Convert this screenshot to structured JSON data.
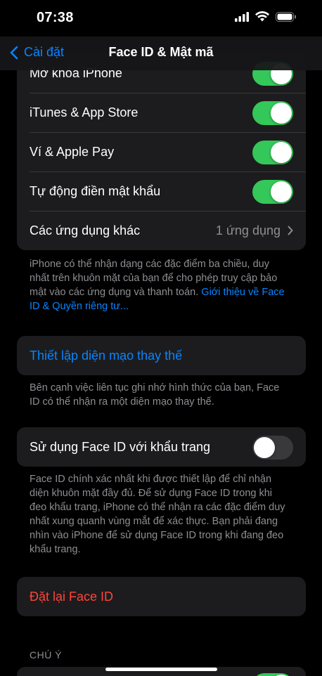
{
  "status": {
    "time": "07:38"
  },
  "nav": {
    "back_label": "Cài đặt",
    "title": "Face ID & Mật mã"
  },
  "use_for": {
    "rows": [
      {
        "label": "Mở khóa iPhone",
        "on": true
      },
      {
        "label": "iTunes & App Store",
        "on": true
      },
      {
        "label": "Ví & Apple Pay",
        "on": true
      },
      {
        "label": "Tự động điền mật khẩu",
        "on": true
      }
    ],
    "other_apps": {
      "label": "Các ứng dụng khác",
      "value": "1 ứng dụng"
    }
  },
  "footer1": {
    "text": "iPhone có thể nhận dạng các đặc điểm ba chiều, duy nhất trên khuôn mặt của bạn để cho phép truy cập bảo mật vào các ứng dụng và thanh toán. ",
    "link": "Giới thiệu về Face ID & Quyền riêng tư..."
  },
  "alt_appearance": {
    "label": "Thiết lập diện mạo thay thế",
    "footer": "Bên cạnh việc liên tục ghi nhớ hình thức của bạn, Face ID có thể nhận ra một diện mạo thay thế."
  },
  "mask": {
    "label": "Sử dụng Face ID với khẩu trang",
    "on": false,
    "footer": "Face ID chính xác nhất khi được thiết lập để chỉ nhận diện khuôn mặt đầy đủ. Để sử dụng Face ID trong khi đeo khẩu trang, iPhone có thể nhận ra các đặc điểm duy nhất xung quanh vùng mắt để xác thực. Bạn phải đang nhìn vào iPhone để sử dụng Face ID trong khi đang đeo khẩu trang."
  },
  "reset": {
    "label": "Đặt lại Face ID"
  },
  "attention": {
    "header": "CHÚ Ý"
  },
  "colors": {
    "accent": "#0a84ff",
    "toggle_on": "#34c759",
    "destructive": "#ff453a",
    "cell_bg": "#1c1c1e"
  },
  "icons": [
    "cellular-signal-icon",
    "wifi-icon",
    "battery-icon",
    "chevron-left-icon",
    "chevron-right-icon"
  ]
}
